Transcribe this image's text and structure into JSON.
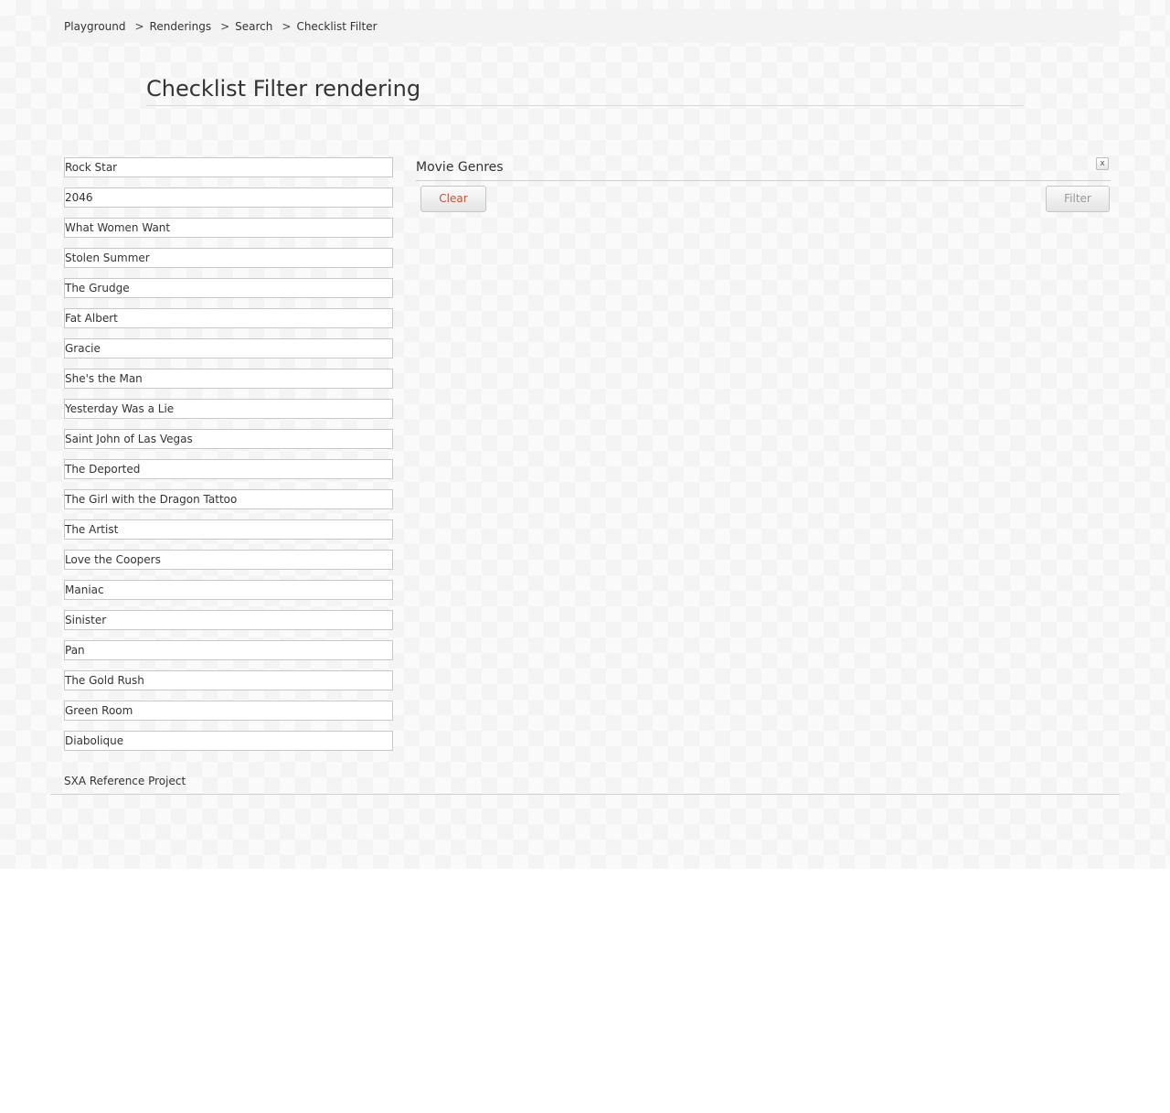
{
  "breadcrumb": {
    "items": [
      "Playground",
      "Renderings",
      "Search"
    ],
    "current": "Checklist Filter",
    "separator": ">"
  },
  "page": {
    "title": "Checklist Filter rendering"
  },
  "movies": [
    "Rock Star",
    "2046",
    "What Women Want",
    "Stolen Summer",
    "The Grudge",
    "Fat Albert",
    "Gracie",
    "She's the Man",
    "Yesterday Was a Lie",
    "Saint John of Las Vegas",
    "The Deported",
    "The Girl with the Dragon Tattoo",
    "The Artist",
    "Love the Coopers",
    "Maniac",
    "Sinister",
    "Pan",
    "The Gold Rush",
    "Green Room",
    "Diabolique"
  ],
  "filter": {
    "title": "Movie Genres",
    "close_label": "x",
    "clear_label": "Clear",
    "filter_label": "Filter",
    "clear_color": "#c0563a",
    "filter_color": "#999999"
  },
  "footer": {
    "text": "SXA Reference Project"
  }
}
